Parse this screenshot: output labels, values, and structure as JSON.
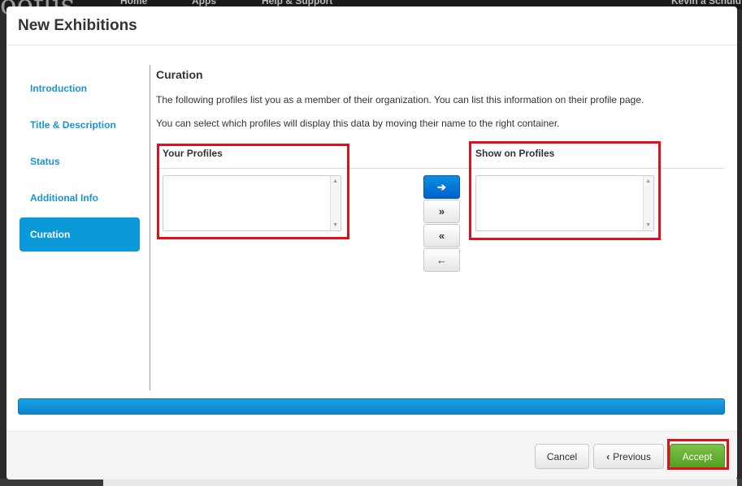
{
  "background": {
    "logo_text": "ooflis",
    "nav": [
      "Home",
      "Apps",
      "Help & Support",
      "Kevin a Schuld"
    ]
  },
  "modal": {
    "title": "New Exhibitions"
  },
  "sidebar": {
    "items": [
      {
        "label": "Introduction",
        "active": false
      },
      {
        "label": "Title & Description",
        "active": false
      },
      {
        "label": "Status",
        "active": false
      },
      {
        "label": "Additional Info",
        "active": false
      },
      {
        "label": "Curation",
        "active": true
      }
    ]
  },
  "content": {
    "section_title": "Curation",
    "paragraph1": "The following profiles list you as a member of their organization. You can list this information on their profile page.",
    "paragraph2": "You can select which profiles will display this data by moving their name to the right container.",
    "left_box_label": "Your Profiles",
    "right_box_label": "Show on Profiles",
    "move_buttons": [
      {
        "icon": "arrow-right-icon",
        "glyph": "➔"
      },
      {
        "icon": "double-chevron-right-icon",
        "glyph": "»"
      },
      {
        "icon": "double-chevron-left-icon",
        "glyph": "«"
      },
      {
        "icon": "arrow-left-icon",
        "glyph": "←"
      }
    ]
  },
  "footer": {
    "cancel_label": "Cancel",
    "previous_label": "Previous",
    "previous_icon": "chevron-left-icon",
    "accept_label": "Accept"
  },
  "colors": {
    "accent": "#0a9ada",
    "link": "#1a94cf",
    "accept": "#5fae2e",
    "highlight": "#e0101a"
  }
}
